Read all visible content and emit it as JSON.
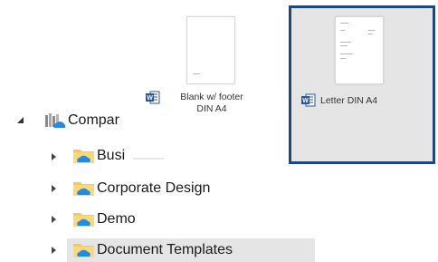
{
  "templates": [
    {
      "label": "Blank w/ footer DIN A4",
      "line1": "Blank w/ footer",
      "line2": "DIN A4",
      "selected": false,
      "icon": "word-doc-icon"
    },
    {
      "label": "Letter DIN A4",
      "selected": true,
      "icon": "word-doc-icon"
    }
  ],
  "tree": {
    "root": {
      "label": "Compar",
      "expanded": true,
      "icon": "library-icon"
    },
    "children": [
      {
        "label": "Busi",
        "icon": "cloud-folder-icon"
      },
      {
        "label": "Corporate Design",
        "icon": "cloud-folder-icon"
      },
      {
        "label": "Demo",
        "icon": "cloud-folder-icon"
      },
      {
        "label": "Document Templates",
        "icon": "cloud-folder-icon",
        "highlighted": true
      }
    ]
  },
  "colors": {
    "selection_border": "#20477c",
    "selection_fill": "#e5e5e5",
    "folder_yellow": "#f6c85f",
    "cloud_blue": "#2a8ad4",
    "word_blue": "#2b579a"
  }
}
